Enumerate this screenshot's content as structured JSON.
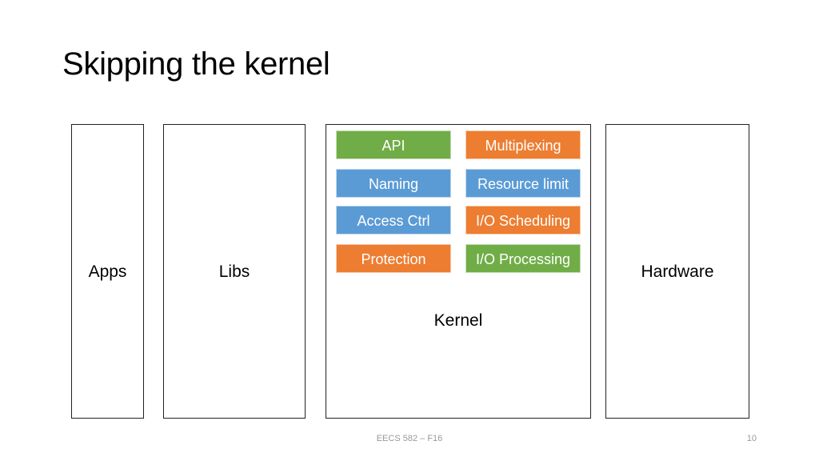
{
  "slide": {
    "title": "Skipping the kernel",
    "boxes": {
      "apps": "Apps",
      "libs": "Libs",
      "kernel": "Kernel",
      "hardware": "Hardware"
    },
    "kernel_components": [
      {
        "label": "API",
        "color": "#70ad47"
      },
      {
        "label": "Multiplexing",
        "color": "#ed7d31"
      },
      {
        "label": "Naming",
        "color": "#5b9bd5"
      },
      {
        "label": "Resource limit",
        "color": "#5b9bd5"
      },
      {
        "label": "Access Ctrl",
        "color": "#5b9bd5"
      },
      {
        "label": "I/O Scheduling",
        "color": "#ed7d31"
      },
      {
        "label": "Protection",
        "color": "#ed7d31"
      },
      {
        "label": "I/O Processing",
        "color": "#70ad47"
      }
    ],
    "footer": "EECS 582 – F16",
    "page_number": "10"
  }
}
